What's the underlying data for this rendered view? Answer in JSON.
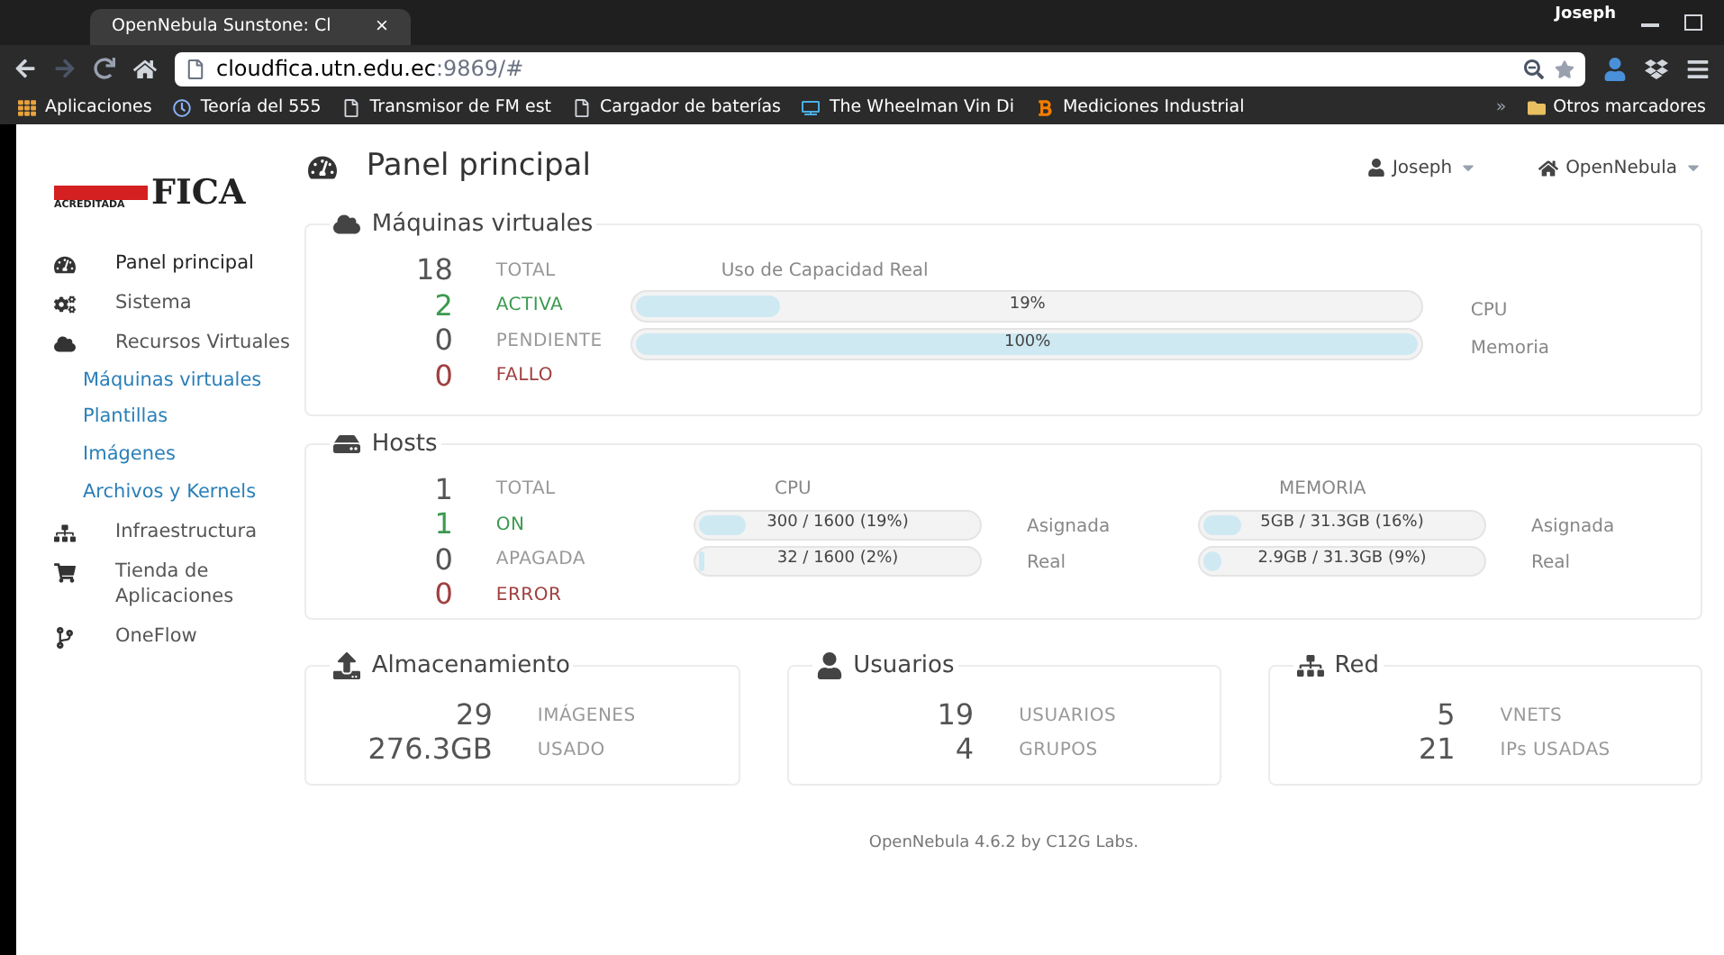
{
  "browser": {
    "tab_title": "OpenNebula Sunstone: Cl",
    "close": "×",
    "profile": "Joseph",
    "address": "cloudfica.utn.edu.ec",
    "address_rest": ":9869/#",
    "bookmarks": [
      {
        "kind": "apps",
        "label": "Aplicaciones"
      },
      {
        "kind": "clock",
        "label": "Teoría del 555"
      },
      {
        "kind": "page",
        "label": "Transmisor de FM est"
      },
      {
        "kind": "page",
        "label": "Cargador de baterías"
      },
      {
        "kind": "tv",
        "label": "The Wheelman Vin Di"
      },
      {
        "kind": "blog",
        "label": "Mediciones Industrial"
      }
    ],
    "more": "»",
    "other_bookmarks": "Otros marcadores"
  },
  "logo": {
    "badge": "ACREDITADA",
    "name": "FICA"
  },
  "header": {
    "title": "Panel principal",
    "user": "Joseph",
    "zone": "OpenNebula"
  },
  "sidebar": {
    "items": [
      {
        "kind": "dashboard",
        "label": "Panel principal",
        "selected": true
      },
      {
        "kind": "system",
        "label": "Sistema",
        "selected": false
      },
      {
        "kind": "virtual",
        "label": "Recursos Virtuales",
        "selected": false,
        "expanded": true,
        "children": [
          {
            "label": "Máquinas virtuales"
          },
          {
            "label": "Plantillas"
          },
          {
            "label": "Imágenes"
          },
          {
            "label": "Archivos y Kernels"
          }
        ]
      },
      {
        "kind": "infra",
        "label": "Infraestructura",
        "selected": false
      },
      {
        "kind": "market",
        "label": "Tienda de Aplicaciones",
        "selected": false
      },
      {
        "kind": "flow",
        "label": "OneFlow",
        "selected": false
      }
    ]
  },
  "vms": {
    "title": "Máquinas virtuales",
    "stats": [
      {
        "value": "18",
        "label": "TOTAL",
        "color": "#555555"
      },
      {
        "value": "2",
        "label": "ACTIVA",
        "color": "#3c9a4f"
      },
      {
        "value": "0",
        "label": "PENDIENTE",
        "color": "#555555"
      },
      {
        "value": "0",
        "label": "FALLO",
        "color": "#a04040"
      }
    ],
    "usage_title": "Uso de Capacidad Real",
    "bars": [
      {
        "text": "19%",
        "level": 0.19,
        "label": "CPU"
      },
      {
        "text": "100%",
        "level": 1,
        "label": "Memoria"
      }
    ]
  },
  "hosts": {
    "title": "Hosts",
    "stats": [
      {
        "value": "1",
        "label": "TOTAL",
        "color": "#555555"
      },
      {
        "value": "1",
        "label": "ON",
        "color": "#3c9a4f"
      },
      {
        "value": "0",
        "label": "APAGADA",
        "color": "#555555"
      },
      {
        "value": "0",
        "label": "ERROR",
        "color": "#a04040"
      }
    ],
    "groups": [
      {
        "title": "CPU",
        "bars": [
          {
            "text": "300 / 1600 (19%)",
            "level": 0.19,
            "label": "Asignada"
          },
          {
            "text": "32 / 1600 (2%)",
            "level": 0.02,
            "label": "Real"
          }
        ]
      },
      {
        "title": "MEMORIA",
        "bars": [
          {
            "text": "5GB / 31.3GB (16%)",
            "level": 0.16,
            "label": "Asignada"
          },
          {
            "text": "2.9GB / 31.3GB (9%)",
            "level": 0.09,
            "label": "Real"
          }
        ]
      }
    ]
  },
  "summaries": [
    {
      "kind": "storage",
      "title": "Almacenamiento",
      "stats": [
        {
          "value": "29",
          "label": "IMÁGENES"
        },
        {
          "value": "276.3GB",
          "label": "USADO"
        }
      ]
    },
    {
      "kind": "users",
      "title": "Usuarios",
      "stats": [
        {
          "value": "19",
          "label": "USUARIOS"
        },
        {
          "value": "4",
          "label": "GRUPOS"
        }
      ]
    },
    {
      "kind": "network",
      "title": "Red",
      "stats": [
        {
          "value": "5",
          "label": "VNETS"
        },
        {
          "value": "21",
          "label": "IPs USADAS"
        }
      ]
    }
  ],
  "footer": "OpenNebula 4.6.2 by C12G Labs."
}
